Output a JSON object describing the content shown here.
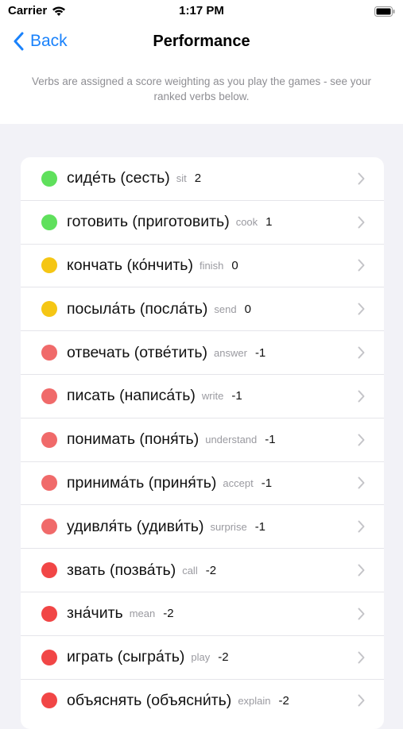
{
  "status": {
    "carrier": "Carrier",
    "time": "1:17 PM"
  },
  "nav": {
    "back_label": "Back",
    "title": "Performance"
  },
  "description": "Verbs are assigned a score weighting as you play the games - see your ranked verbs below.",
  "colors": {
    "green": "#5fe05c",
    "yellow": "#f5c614",
    "light_red": "#f06a6a",
    "red": "#f14646",
    "accent": "#1a82fb"
  },
  "verbs": [
    {
      "verb": "сиде́ть (сесть)",
      "translation": "sit",
      "score": "2",
      "color": "#5fe05c"
    },
    {
      "verb": "готовить (приготовить)",
      "translation": "cook",
      "score": "1",
      "color": "#5fe05c"
    },
    {
      "verb": "кончать (ко́нчить)",
      "translation": "finish",
      "score": "0",
      "color": "#f5c614"
    },
    {
      "verb": "посыла́ть (посла́ть)",
      "translation": "send",
      "score": "0",
      "color": "#f5c614"
    },
    {
      "verb": "отвечать (отве́тить)",
      "translation": "answer",
      "score": "-1",
      "color": "#f06a6a"
    },
    {
      "verb": "писать (написа́ть)",
      "translation": "write",
      "score": "-1",
      "color": "#f06a6a"
    },
    {
      "verb": "понимать (поня́ть)",
      "translation": "understand",
      "score": "-1",
      "color": "#f06a6a"
    },
    {
      "verb": "принима́ть (приня́ть)",
      "translation": "accept",
      "score": "-1",
      "color": "#f06a6a"
    },
    {
      "verb": "удивля́ть (удиви́ть)",
      "translation": "surprise",
      "score": "-1",
      "color": "#f06a6a"
    },
    {
      "verb": "звать (позва́ть)",
      "translation": "call",
      "score": "-2",
      "color": "#f14646"
    },
    {
      "verb": "зна́чить",
      "translation": "mean",
      "score": "-2",
      "color": "#f14646"
    },
    {
      "verb": "играть (сыгра́ть)",
      "translation": "play",
      "score": "-2",
      "color": "#f14646"
    },
    {
      "verb": "объяснять (объясни́ть)",
      "translation": "explain",
      "score": "-2",
      "color": "#f14646"
    }
  ]
}
